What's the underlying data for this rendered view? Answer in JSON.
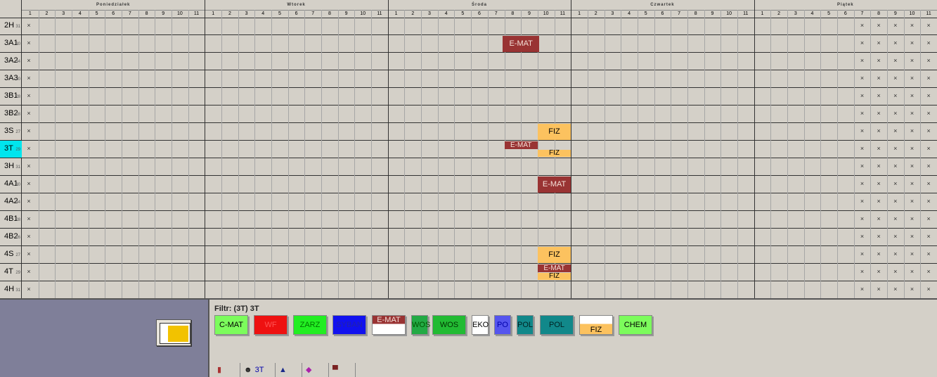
{
  "days": [
    "Poniedziałek",
    "Wtorek",
    "Środa",
    "Czwartek",
    "Piątek"
  ],
  "periods": [
    "1",
    "2",
    "3",
    "4",
    "5",
    "6",
    "7",
    "8",
    "9",
    "10",
    "11"
  ],
  "classes": [
    {
      "name": "2H",
      "count": "31"
    },
    {
      "name": "3A1",
      "count": "30"
    },
    {
      "name": "3A2",
      "count": "34"
    },
    {
      "name": "3A3",
      "count": "30"
    },
    {
      "name": "3B1",
      "count": "28"
    },
    {
      "name": "3B2",
      "count": "28"
    },
    {
      "name": "3S",
      "count": "27"
    },
    {
      "name": "3T",
      "count": "29",
      "selected": true
    },
    {
      "name": "3H",
      "count": "31"
    },
    {
      "name": "4A1",
      "count": "30"
    },
    {
      "name": "4A2",
      "count": "34"
    },
    {
      "name": "4B1",
      "count": "28"
    },
    {
      "name": "4B2",
      "count": "26"
    },
    {
      "name": "4S",
      "count": "27"
    },
    {
      "name": "4T",
      "count": "29"
    },
    {
      "name": "4H",
      "count": "31"
    }
  ],
  "unavailable_mark": "×",
  "unavailable": {
    "monday_period1_all_rows": true,
    "friday_periods": [
      7,
      8,
      9,
      10,
      11
    ]
  },
  "lessons": [
    {
      "row": 1,
      "day": 2,
      "period_start": 7.9,
      "period_end": 10.1,
      "label": "E-MAT",
      "kind": "emat",
      "part": "full"
    },
    {
      "row": 6,
      "day": 2,
      "period_start": 10,
      "period_end": 12,
      "label": "FIZ",
      "kind": "fiz",
      "part": "full"
    },
    {
      "row": 7,
      "day": 2,
      "period_start": 8,
      "period_end": 10,
      "label": "E-MAT",
      "kind": "emat",
      "part": "top"
    },
    {
      "row": 7,
      "day": 2,
      "period_start": 10,
      "period_end": 12,
      "label": "FIZ",
      "kind": "fiz",
      "part": "bottom"
    },
    {
      "row": 9,
      "day": 2,
      "period_start": 10,
      "period_end": 12,
      "label": "E-MAT",
      "kind": "emat",
      "part": "full"
    },
    {
      "row": 13,
      "day": 2,
      "period_start": 10,
      "period_end": 12,
      "label": "FIZ",
      "kind": "fiz",
      "part": "full"
    },
    {
      "row": 14,
      "day": 2,
      "period_start": 10,
      "period_end": 12,
      "label": "E-MAT",
      "kind": "emat",
      "part": "top"
    },
    {
      "row": 14,
      "day": 2,
      "period_start": 10,
      "period_end": 12,
      "label": "FIZ",
      "kind": "fiz",
      "part": "bottom"
    }
  ],
  "filter_label": "Filtr: (3T) 3T",
  "subject_cards": [
    {
      "label": "C-MAT",
      "bg": "#7cfc5c",
      "fg": "#000000"
    },
    {
      "label": "WF",
      "bg": "#ee1111",
      "fg": "#ff5555"
    },
    {
      "label": "ZARZ",
      "bg": "#22ee22",
      "fg": "#007700"
    },
    {
      "label": "SYBAN",
      "bg": "#1111ee",
      "fg": "#2222aa"
    },
    {
      "label": "E-MAT",
      "bg": "#993333",
      "fg": "#f4e0d8",
      "half": true
    },
    {
      "label": "WOS",
      "bg": "#22aa44",
      "fg": "#005500"
    },
    {
      "label": "WOS",
      "bg": "#22bb33",
      "fg": "#003300"
    },
    {
      "label": "EKO",
      "bg": "#ffffff",
      "fg": "#000000"
    },
    {
      "label": "PO",
      "bg": "#5555ee",
      "fg": "#0000aa"
    },
    {
      "label": "POL",
      "bg": "#11888a",
      "fg": "#002222"
    },
    {
      "label": "POL",
      "bg": "#11888a",
      "fg": "#002222"
    },
    {
      "label": "FIZ",
      "bg": "#fcc25f",
      "fg": "#000000",
      "half": true
    },
    {
      "label": "CHEM",
      "bg": "#7cfc5c",
      "fg": "#000000"
    }
  ],
  "tabs": [
    {
      "icon": "chart-icon",
      "label": ""
    },
    {
      "icon": "teacher-icon",
      "label": "3T"
    },
    {
      "icon": "graduation-cap-icon",
      "label": ""
    },
    {
      "icon": "book-icon",
      "label": ""
    },
    {
      "icon": "desk-icon",
      "label": ""
    }
  ]
}
